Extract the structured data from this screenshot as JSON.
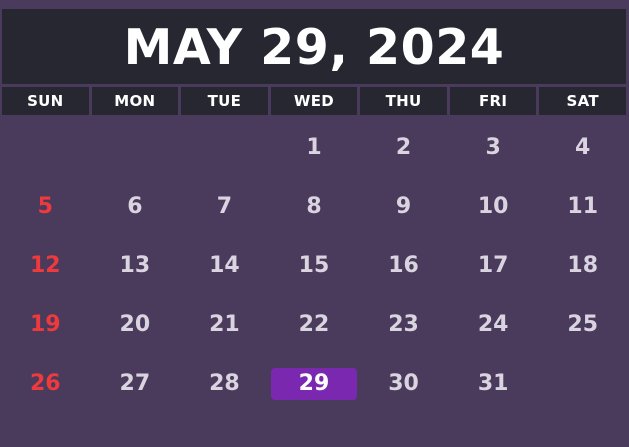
{
  "title": "MAY 29, 2024",
  "accent_today_color": "#7a28b0",
  "sunday_color": "#ee3a3d",
  "weekdays": [
    "SUN",
    "MON",
    "TUE",
    "WED",
    "THU",
    "FRI",
    "SAT"
  ],
  "weeks": [
    [
      "",
      "",
      "",
      "1",
      "2",
      "3",
      "4"
    ],
    [
      "5",
      "6",
      "7",
      "8",
      "9",
      "10",
      "11"
    ],
    [
      "12",
      "13",
      "14",
      "15",
      "16",
      "17",
      "18"
    ],
    [
      "19",
      "20",
      "21",
      "22",
      "23",
      "24",
      "25"
    ],
    [
      "26",
      "27",
      "28",
      "29",
      "30",
      "31",
      ""
    ]
  ],
  "selected_day": "29"
}
